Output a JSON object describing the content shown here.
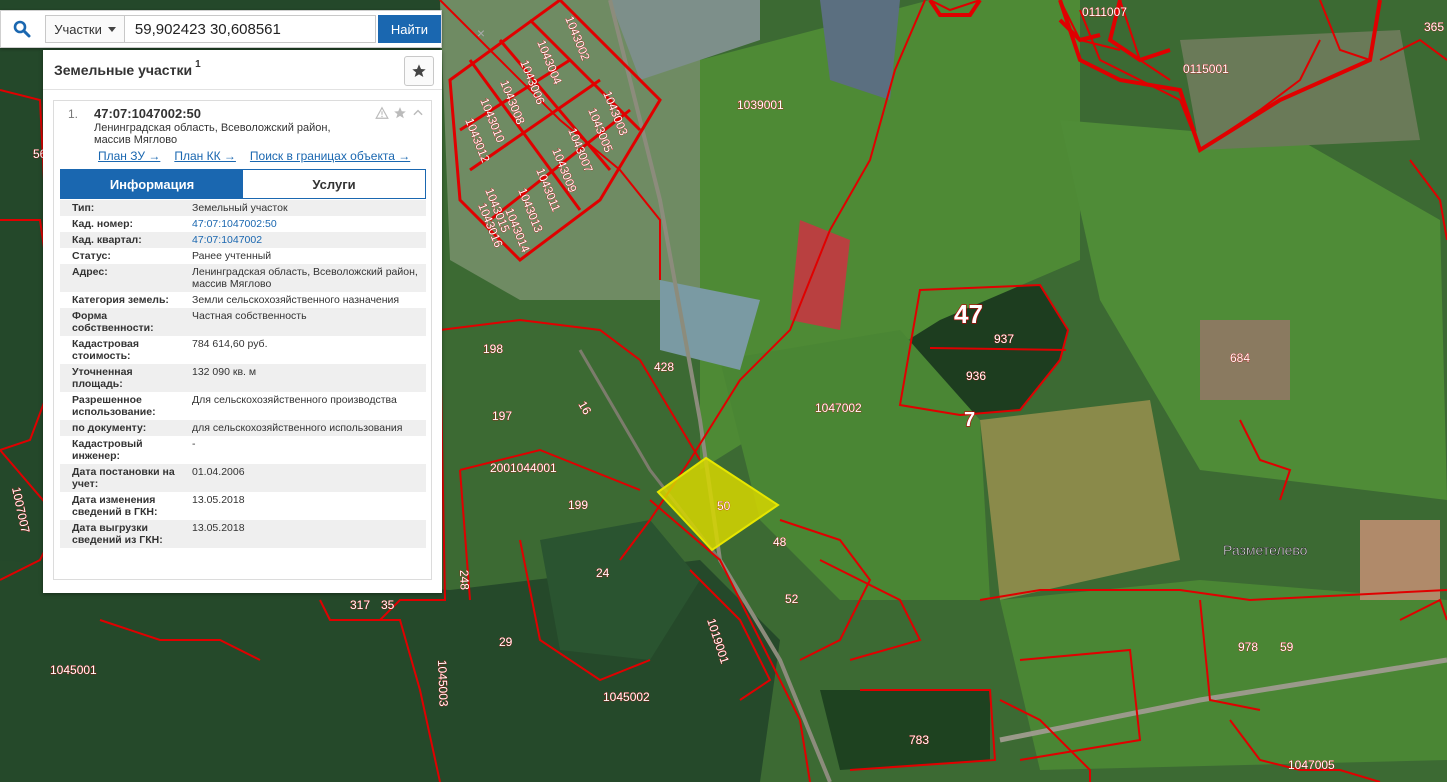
{
  "search": {
    "type_label": "Участки",
    "query_value": "59,902423 30,608561",
    "find_label": "Найти",
    "clear_symbol": "×"
  },
  "panel": {
    "title": "Земельные участки",
    "count": "1",
    "result": {
      "number": "1.",
      "cadastral_number": "47:07:1047002:50",
      "address": "Ленинградская область, Всеволожский район, массив Мяглово",
      "links": [
        "План ЗУ →",
        "План КК →",
        "Поиск в границах объекта →"
      ]
    },
    "tabs": [
      "Информация",
      "Услуги"
    ],
    "info": [
      {
        "key": "Тип:",
        "value": "Земельный участок"
      },
      {
        "key": "Кад. номер:",
        "value": "47:07:1047002:50"
      },
      {
        "key": "Кад. квартал:",
        "value": "47:07:1047002"
      },
      {
        "key": "Статус:",
        "value": "Ранее учтенный"
      },
      {
        "key": "Адрес:",
        "value": "Ленинградская область, Всеволожский район, массив Мяглово"
      },
      {
        "key": "Категория земель:",
        "value": "Земли сельскохозяйственного назначения"
      },
      {
        "key": "Форма собственности:",
        "value": "Частная собственность"
      },
      {
        "key": "Кадастровая стоимость:",
        "value": "784 614,60 руб."
      },
      {
        "key": "Уточненная площадь:",
        "value": "132 090 кв. м"
      },
      {
        "key": "Разрешенное использование:",
        "value": "Для сельскохозяйственного производства"
      },
      {
        "key": "по документу:",
        "value": "для сельскохозяйственного использования"
      },
      {
        "key": "Кадастровый инженер:",
        "value": "-"
      },
      {
        "key": "Дата постановки на учет:",
        "value": "01.04.2006"
      },
      {
        "key": "Дата изменения сведений в ГКН:",
        "value": "13.05.2018"
      },
      {
        "key": "Дата выгрузки сведений из ГКН:",
        "value": "13.05.2018"
      }
    ]
  },
  "map": {
    "labels": {
      "q1039001": "1039001",
      "q1047002": "1047002",
      "q1044001": "1044001",
      "q1045001": "1045001",
      "q1045002": "1045002",
      "q1047005": "1047005",
      "q0111007": "0111007",
      "q0115001": "0115001",
      "q1019001": "1019001",
      "q1007007": "1007007",
      "q1045003": "1045003",
      "p50": "50",
      "p48": "48",
      "p52": "52",
      "p24": "24",
      "p29": "29",
      "p199": "199",
      "p200": "200",
      "p197": "197",
      "p198": "198",
      "p428": "428",
      "p16": "16",
      "p937": "937",
      "p936": "936",
      "p684": "684",
      "p978": "978",
      "p59": "59",
      "p783": "783",
      "p317": "317",
      "p35": "35",
      "p248": "248",
      "p365": "365",
      "p56": "56",
      "big47": "47",
      "big7": "7",
      "town": "Разметелево",
      "q1043002": "1043002",
      "q1043003": "1043003",
      "q1043004": "1043004",
      "q1043005": "1043005",
      "q1043006": "1043006",
      "q1043007": "1043007",
      "q1043008": "1043008",
      "q1043009": "1043009",
      "q1043010": "1043010",
      "q1043011": "1043011",
      "q1043012": "1043012",
      "q1043013": "1043013",
      "q1043014": "1043014",
      "q1043015": "1043015",
      "q1043016": "1043016",
      "q1043005b": "1043005"
    },
    "colors": {
      "boundary": "#e00000",
      "selected_fill": "#d6d600",
      "field": "#4e8a35",
      "forest": "#1f4420"
    }
  }
}
